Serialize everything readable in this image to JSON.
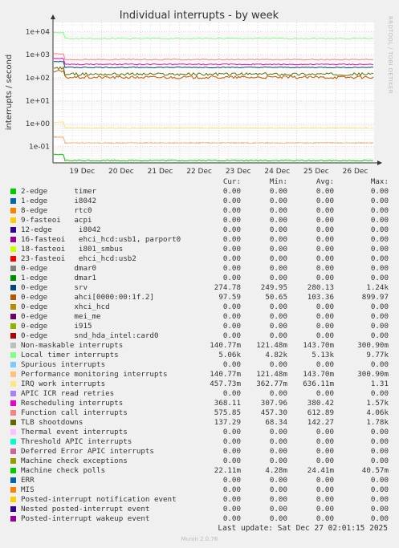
{
  "chart_data": {
    "type": "line",
    "title": "Individual interrupts - by week",
    "ylabel": "interrupts / second",
    "side_text": "RRDTOOL / TOBI OETIKER",
    "yscale": "log",
    "ylim": [
      0.03,
      20000
    ],
    "y_ticks": [
      "1e-01",
      "1e+00",
      "1e+01",
      "1e+02",
      "1e+03",
      "1e+04"
    ],
    "x_ticks": [
      "19 Dec",
      "20 Dec",
      "21 Dec",
      "22 Dec",
      "23 Dec",
      "24 Dec",
      "25 Dec",
      "26 Dec"
    ],
    "columns": [
      "Cur:",
      "Min:",
      "Avg:",
      "Max:"
    ],
    "series": [
      {
        "name": "2-edge      timer",
        "color": "#00cc00",
        "values": [
          "0.00",
          "0.00",
          "0.00",
          "0.00"
        ]
      },
      {
        "name": "1-edge      i8042",
        "color": "#0066b3",
        "values": [
          "0.00",
          "0.00",
          "0.00",
          "0.00"
        ]
      },
      {
        "name": "8-edge      rtc0",
        "color": "#ff8000",
        "values": [
          "0.00",
          "0.00",
          "0.00",
          "0.00"
        ]
      },
      {
        "name": "9-fasteoi   acpi",
        "color": "#ffcc00",
        "values": [
          "0.00",
          "0.00",
          "0.00",
          "0.00"
        ]
      },
      {
        "name": "12-edge      i8042",
        "color": "#330099",
        "values": [
          "0.00",
          "0.00",
          "0.00",
          "0.00"
        ]
      },
      {
        "name": "16-fasteoi   ehci_hcd:usb1, parport0",
        "color": "#990099",
        "values": [
          "0.00",
          "0.00",
          "0.00",
          "0.00"
        ]
      },
      {
        "name": "18-fasteoi   i801_smbus",
        "color": "#ccff00",
        "values": [
          "0.00",
          "0.00",
          "0.00",
          "0.00"
        ]
      },
      {
        "name": "23-fasteoi   ehci_hcd:usb2",
        "color": "#ff0000",
        "values": [
          "0.00",
          "0.00",
          "0.00",
          "0.00"
        ]
      },
      {
        "name": "0-edge      dmar0",
        "color": "#808080",
        "values": [
          "0.00",
          "0.00",
          "0.00",
          "0.00"
        ]
      },
      {
        "name": "1-edge      dmar1",
        "color": "#008f00",
        "values": [
          "0.00",
          "0.00",
          "0.00",
          "0.00"
        ]
      },
      {
        "name": "0-edge      srv",
        "color": "#00487d",
        "values": [
          "274.78",
          "249.95",
          "280.13",
          "1.24k"
        ]
      },
      {
        "name": "0-edge      ahci[0000:00:1f.2]",
        "color": "#b35a00",
        "values": [
          "97.59",
          "50.65",
          "103.36",
          "899.97"
        ]
      },
      {
        "name": "0-edge      xhci_hcd",
        "color": "#b38f00",
        "values": [
          "0.00",
          "0.00",
          "0.00",
          "0.00"
        ]
      },
      {
        "name": "0-edge      mei_me",
        "color": "#6b006b",
        "values": [
          "0.00",
          "0.00",
          "0.00",
          "0.00"
        ]
      },
      {
        "name": "0-edge      i915",
        "color": "#8fb300",
        "values": [
          "0.00",
          "0.00",
          "0.00",
          "0.00"
        ]
      },
      {
        "name": "0-edge      snd_hda_intel:card0",
        "color": "#b30000",
        "values": [
          "0.00",
          "0.00",
          "0.00",
          "0.00"
        ]
      },
      {
        "name": "Non-maskable interrupts",
        "color": "#bebebe",
        "values": [
          "140.77m",
          "121.48m",
          "143.70m",
          "300.90m"
        ]
      },
      {
        "name": "Local timer interrupts",
        "color": "#80ff80",
        "values": [
          "5.06k",
          "4.82k",
          "5.13k",
          "9.77k"
        ]
      },
      {
        "name": "Spurious interrupts",
        "color": "#80c9ff",
        "values": [
          "0.00",
          "0.00",
          "0.00",
          "0.00"
        ]
      },
      {
        "name": "Performance monitoring interrupts",
        "color": "#ffc080",
        "values": [
          "140.77m",
          "121.48m",
          "143.70m",
          "300.90m"
        ]
      },
      {
        "name": "IRQ work interrupts",
        "color": "#ffe680",
        "values": [
          "457.73m",
          "362.77m",
          "636.11m",
          "1.31"
        ]
      },
      {
        "name": "APIC ICR read retries",
        "color": "#aa80ff",
        "values": [
          "0.00",
          "0.00",
          "0.00",
          "0.00"
        ]
      },
      {
        "name": "Rescheduling interrupts",
        "color": "#ee00cc",
        "values": [
          "368.11",
          "307.96",
          "380.42",
          "1.57k"
        ]
      },
      {
        "name": "Function call interrupts",
        "color": "#ff8080",
        "values": [
          "575.85",
          "457.30",
          "612.89",
          "4.06k"
        ]
      },
      {
        "name": "TLB shootdowns",
        "color": "#666600",
        "values": [
          "137.29",
          "68.34",
          "142.27",
          "1.78k"
        ]
      },
      {
        "name": "Thermal event interrupts",
        "color": "#ffbfff",
        "values": [
          "0.00",
          "0.00",
          "0.00",
          "0.00"
        ]
      },
      {
        "name": "Threshold APIC interrupts",
        "color": "#00ffcc",
        "values": [
          "0.00",
          "0.00",
          "0.00",
          "0.00"
        ]
      },
      {
        "name": "Deferred Error APIC interrupts",
        "color": "#cc6699",
        "values": [
          "0.00",
          "0.00",
          "0.00",
          "0.00"
        ]
      },
      {
        "name": "Machine check exceptions",
        "color": "#999900",
        "values": [
          "0.00",
          "0.00",
          "0.00",
          "0.00"
        ]
      },
      {
        "name": "Machine check polls",
        "color": "#00cc00",
        "values": [
          "22.11m",
          "4.28m",
          "24.41m",
          "40.57m"
        ]
      },
      {
        "name": "ERR",
        "color": "#0066b3",
        "values": [
          "0.00",
          "0.00",
          "0.00",
          "0.00"
        ]
      },
      {
        "name": "MIS",
        "color": "#ff8000",
        "values": [
          "0.00",
          "0.00",
          "0.00",
          "0.00"
        ]
      },
      {
        "name": "Posted-interrupt notification event",
        "color": "#ffcc00",
        "values": [
          "0.00",
          "0.00",
          "0.00",
          "0.00"
        ]
      },
      {
        "name": "Nested posted-interrupt event",
        "color": "#330099",
        "values": [
          "0.00",
          "0.00",
          "0.00",
          "0.00"
        ]
      },
      {
        "name": "Posted-interrupt wakeup event",
        "color": "#990099",
        "values": [
          "0.00",
          "0.00",
          "0.00",
          "0.00"
        ]
      }
    ]
  },
  "footer": {
    "last_update": "Last update: Sat Dec 27 02:01:15 2025",
    "munin": "Munin 2.0.76"
  }
}
